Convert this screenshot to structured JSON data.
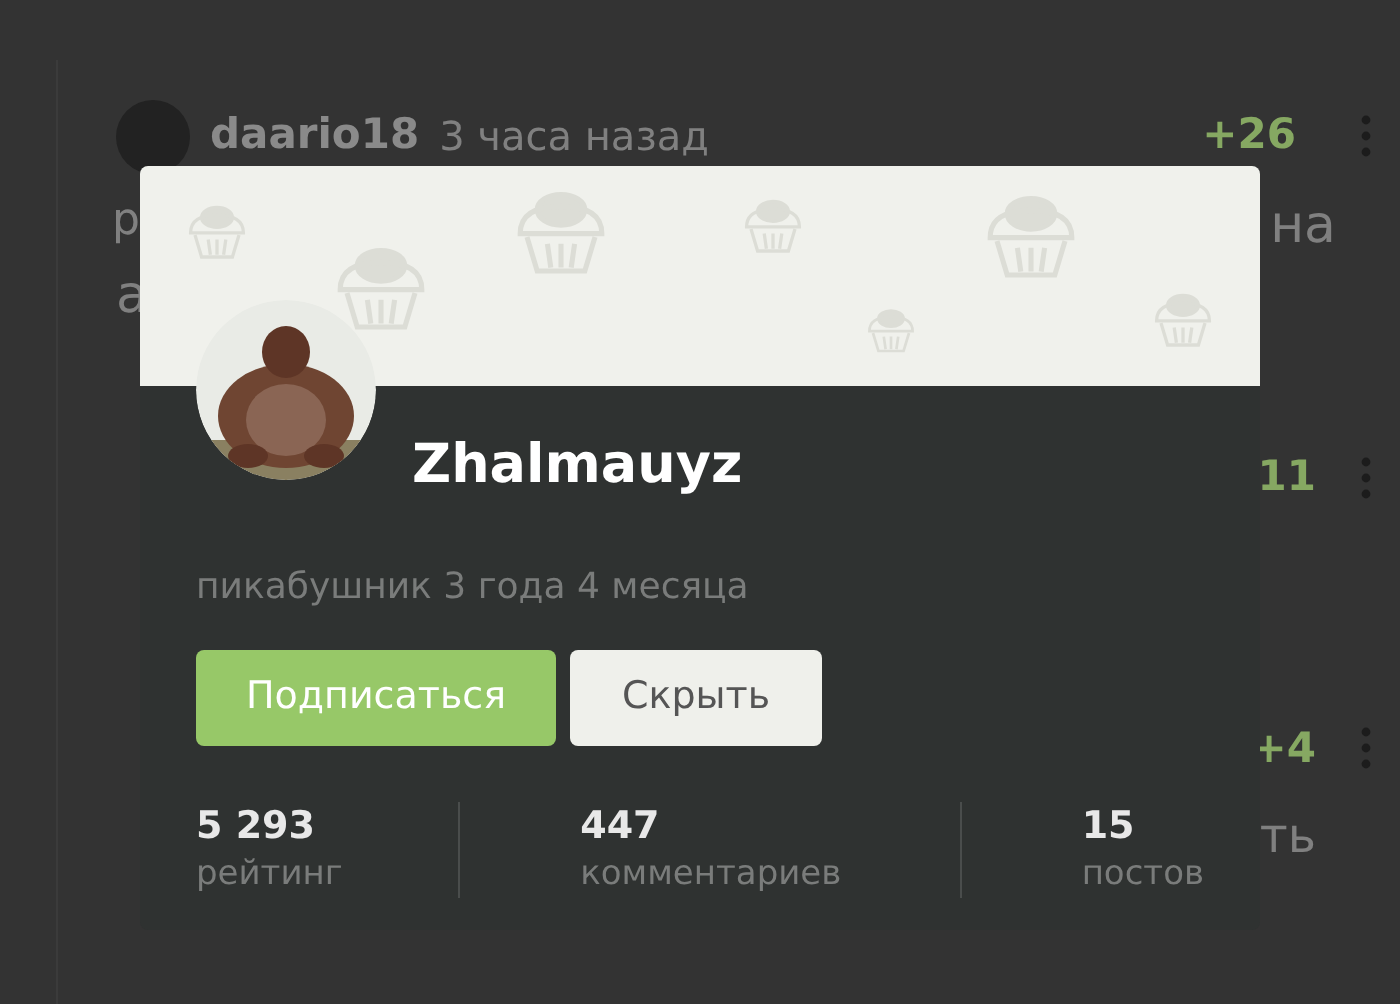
{
  "comment": {
    "author": "daario18",
    "time": "3 часа назад",
    "rating": "+26",
    "text_fragments": [
      "р",
      "на",
      "а"
    ]
  },
  "replies": [
    {
      "rating": "11"
    },
    {
      "rating": "+4",
      "text_fragment": "ть"
    }
  ],
  "profile_card": {
    "username": "Zhalmauyz",
    "subtitle": "пикабушник 3 года 4 месяца",
    "buttons": [
      {
        "label": "Подписаться",
        "kind": "primary"
      },
      {
        "label": "Скрыть",
        "kind": "secondary"
      }
    ],
    "stats": [
      {
        "value": "5 293",
        "label": "рейтинг"
      },
      {
        "value": "447",
        "label": "комментариев"
      },
      {
        "value": "15",
        "label": "постов"
      }
    ]
  }
}
